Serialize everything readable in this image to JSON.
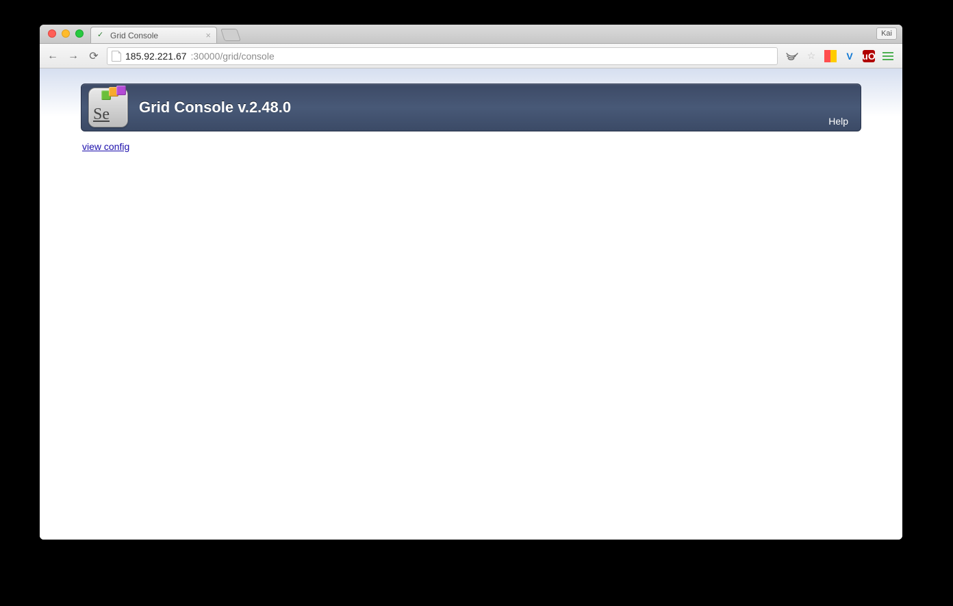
{
  "window": {
    "profile": "Kai"
  },
  "tab": {
    "title": "Grid Console"
  },
  "toolbar": {
    "url_host": "185.92.221.67",
    "url_rest": ":30000/grid/console",
    "ublock_label": "uO"
  },
  "page": {
    "header_title": "Grid Console v.2.48.0",
    "help": "Help",
    "logo_text": "Se",
    "view_config": "view config"
  }
}
